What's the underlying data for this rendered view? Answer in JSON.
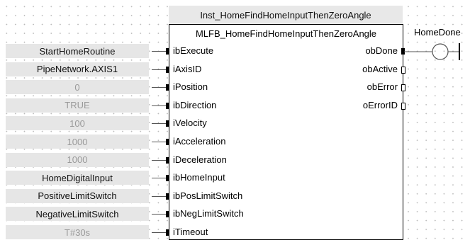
{
  "instance": {
    "name": "Inst_HomeFindHomeInputThenZeroAngle"
  },
  "block": {
    "type": "MLFB_HomeFindHomeInputThenZeroAngle"
  },
  "inputs": [
    {
      "pin": "ibExecute",
      "value": "StartHomeRoutine",
      "kind": "var"
    },
    {
      "pin": "iAxisID",
      "value": "PipeNetwork.AXIS1",
      "kind": "var"
    },
    {
      "pin": "iPosition",
      "value": "0",
      "kind": "default"
    },
    {
      "pin": "ibDirection",
      "value": "TRUE",
      "kind": "default"
    },
    {
      "pin": "iVelocity",
      "value": "100",
      "kind": "default"
    },
    {
      "pin": "iAcceleration",
      "value": "1000",
      "kind": "default"
    },
    {
      "pin": "iDeceleration",
      "value": "1000",
      "kind": "default"
    },
    {
      "pin": "ibHomeInput",
      "value": "HomeDigitalInput",
      "kind": "var"
    },
    {
      "pin": "ibPosLimitSwitch",
      "value": "PositiveLimitSwitch",
      "kind": "var"
    },
    {
      "pin": "ibNegLimitSwitch",
      "value": "NegativeLimitSwitch",
      "kind": "var"
    },
    {
      "pin": "iTimeout",
      "value": "T#30s",
      "kind": "default"
    }
  ],
  "outputs": [
    {
      "pin": "obDone",
      "connected": true
    },
    {
      "pin": "obActive",
      "connected": false
    },
    {
      "pin": "obError",
      "connected": false
    },
    {
      "pin": "oErrorID",
      "connected": false
    }
  ],
  "coil": {
    "label": "HomeDone",
    "icon": "coil-icon"
  }
}
